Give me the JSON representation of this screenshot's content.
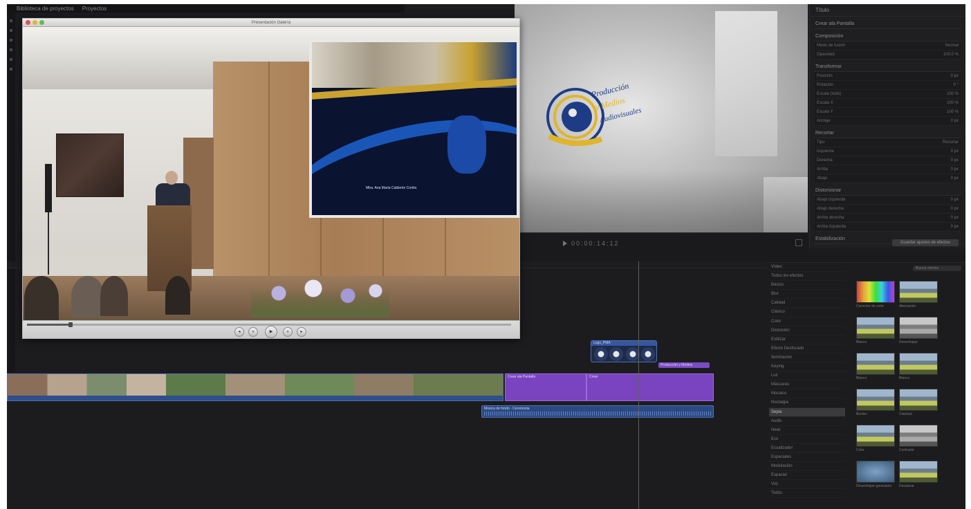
{
  "menubar": {
    "window_title": "Biblioteca de proyectos",
    "event_label": "Proyectos"
  },
  "player": {
    "title": "Presentación Galería"
  },
  "slide": {
    "caption": "Mtra. Ana María Calderón Cortés"
  },
  "logo": {
    "line1": "Producción",
    "line2": "y Medios",
    "line3": "Audiovisuales"
  },
  "viewer": {
    "timecode": "00:00:14:12"
  },
  "inspector": {
    "header": "Título",
    "clip_name": "Crear ala Pantalla",
    "sections": [
      {
        "title": "Composición",
        "rows": [
          [
            "Modo de fusión",
            "Normal"
          ],
          [
            "Opacidad",
            "100,0 %"
          ]
        ]
      },
      {
        "title": "Transformar",
        "rows": [
          [
            "Posición",
            "0 px"
          ],
          [
            "Rotación",
            "0 °"
          ],
          [
            "Escala (todo)",
            "100 %"
          ],
          [
            "Escala X",
            "100 %"
          ],
          [
            "Escala Y",
            "100 %"
          ],
          [
            "Anclaje",
            "0 px"
          ]
        ]
      },
      {
        "title": "Recortar",
        "rows": [
          [
            "Tipo",
            "Recortar"
          ],
          [
            "Izquierda",
            "0 px"
          ],
          [
            "Derecha",
            "0 px"
          ],
          [
            "Arriba",
            "0 px"
          ],
          [
            "Abajo",
            "0 px"
          ]
        ]
      },
      {
        "title": "Distorsionar",
        "rows": [
          [
            "Abajo izquierda",
            "0 px"
          ],
          [
            "Abajo derecha",
            "0 px"
          ],
          [
            "Arriba derecha",
            "0 px"
          ],
          [
            "Arriba izquierda",
            "0 px"
          ]
        ]
      }
    ],
    "footer_label": "Estabilización",
    "action_button": "Guardar ajustes de efectos"
  },
  "timeline": {
    "overlay_clip_label": "Logo_PMA",
    "title_clip_label": "Producción y Medios",
    "purple_clip_1": "Crear ala Pantalla",
    "purple_clip_2": "Crear",
    "audio_clip_label": "Música de fondo - Ceremonia"
  },
  "browser": {
    "search_placeholder": "Buscar efectos",
    "categories": [
      "Vídeo",
      "Todos los efectos",
      "Básico",
      "Blur",
      "Calidad",
      "Clásico",
      "Color",
      "Distorsión",
      "Estilizar",
      "Efecto Desfocado",
      "Iluminación",
      "Keying",
      "Luz",
      "Máscaras",
      "Mosaico",
      "Nostalgia",
      "Sepia",
      "Audio",
      "Nivel",
      "Eco",
      "Ecualizador",
      "Especiales",
      "Modulación",
      "Espacial",
      "Voz",
      "Todos"
    ],
    "selected_category": "Sepia",
    "thumbnails": [
      {
        "label": "Corrector de color",
        "kind": "bars"
      },
      {
        "label": "Aberración",
        "kind": "mountain"
      },
      {
        "label": "Blanco",
        "kind": "mountain"
      },
      {
        "label": "Desenfoque",
        "kind": "mountain-gray"
      },
      {
        "label": "Blanco",
        "kind": "mountain"
      },
      {
        "label": "Blanco",
        "kind": "mountain"
      },
      {
        "label": "Bordes",
        "kind": "mountain"
      },
      {
        "label": "Claridad",
        "kind": "mountain"
      },
      {
        "label": "Color",
        "kind": "mountain"
      },
      {
        "label": "Contraste",
        "kind": "mountain-gray"
      },
      {
        "label": "Desenfoque gaussiano",
        "kind": "blur"
      },
      {
        "label": "Desaturar",
        "kind": "mountain"
      }
    ]
  }
}
